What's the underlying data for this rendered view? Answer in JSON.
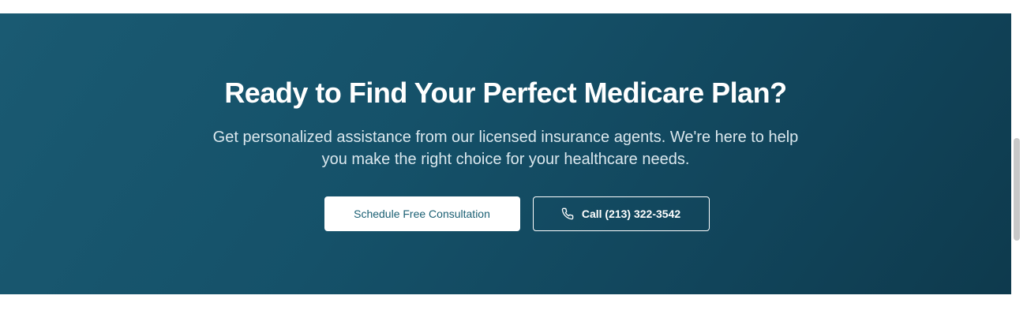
{
  "cta": {
    "title": "Ready to Find Your Perfect Medicare Plan?",
    "subtitle": "Get personalized assistance from our licensed insurance agents. We're here to help you make the right choice for your healthcare needs.",
    "primary_button": "Schedule Free Consultation",
    "call_button": "Call (213) 322-3542",
    "call_icon": "phone-icon"
  },
  "colors": {
    "band_start": "#1a5a72",
    "band_end": "#0e3a4d",
    "primary_button_text": "#1a5f73"
  }
}
